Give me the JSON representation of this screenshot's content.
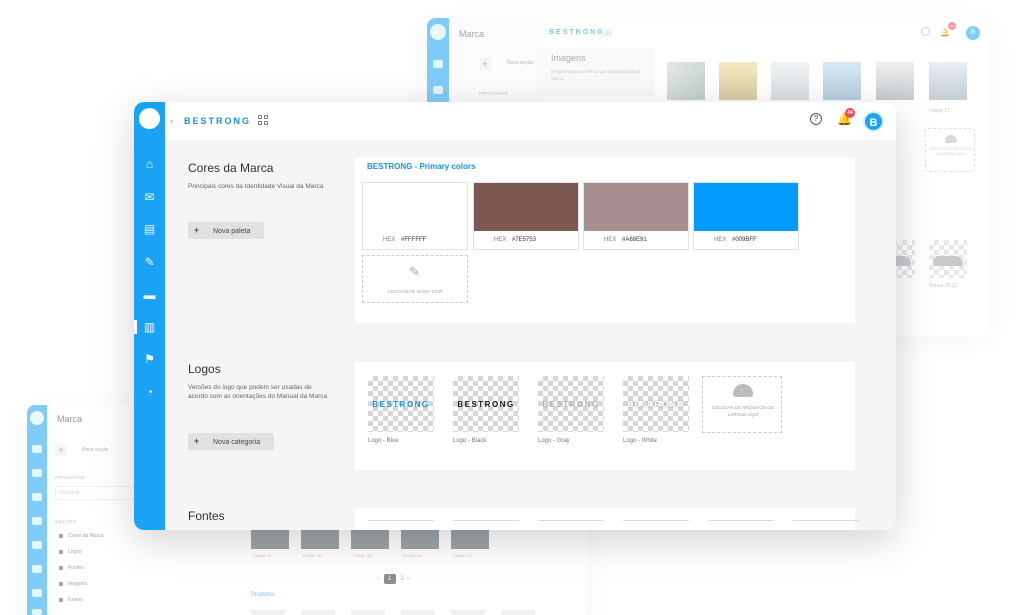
{
  "bg_top": {
    "title": "Marca",
    "new_section": "Nova seção",
    "search_label": "PROCURAR",
    "brand": "BESTRONG",
    "notif_count": "44",
    "avatar": "B",
    "images_title": "Imagens",
    "images_desc": "Imagem para uso em peças Institucionais da Marca",
    "caps": [
      "8",
      "Image 17"
    ],
    "upload_text": "ESCOLHA OS ARQUIVOS OU LARGUE AQUI",
    "shoe_caps": [
      "2",
      "Shoes 03 (2)"
    ]
  },
  "bg_bottom": {
    "title": "Marca",
    "new_section": "Nova seção",
    "search_label": "PROCURAR",
    "search_placeholder": "Procurar...",
    "sections_label": "SEÇÕES",
    "sections": [
      "Cores da Marca",
      "Logos",
      "Fontes",
      "Imagens",
      "Ícones"
    ],
    "gallery_caps": [
      "Image 11",
      "Image 10",
      "Image 15",
      "Image 14",
      "Image 12"
    ],
    "pages": [
      "1",
      "2"
    ],
    "products_label": "Produtos"
  },
  "main": {
    "brand": "BESTRONG",
    "notif_count": "44",
    "avatar": "B",
    "help": "?",
    "colors": {
      "title": "Cores da Marca",
      "desc": "Principais cores da Identidade Visual da Marca",
      "button": "Nova paleta",
      "panel_title": "BESTRONG - Primary colors",
      "hex_label": "HEX",
      "swatches": [
        {
          "hex": "#FFFFFF",
          "color": "#FFFFFF"
        },
        {
          "hex": "#7E5753",
          "color": "#7E5753"
        },
        {
          "hex": "#A68E91",
          "color": "#A68E91"
        },
        {
          "hex": "#009BFF",
          "color": "#009BFF"
        }
      ],
      "add_color": "ADICIONAR NOVA COR"
    },
    "logos": {
      "title": "Logos",
      "desc": "Versões do logo que podem ser usadas de acordo com as orientações do Manual da Marca",
      "button": "Nova categoria",
      "wordmark": "BESTRONG",
      "items": [
        {
          "label": "Logo - Blue",
          "color": "#1793e6"
        },
        {
          "label": "Logo - Black",
          "color": "#1a1a1a"
        },
        {
          "label": "Logo - Gray",
          "color": "#b3b3b3"
        },
        {
          "label": "Logo - White",
          "color": "#ffffff"
        }
      ],
      "upload_text": "ESCOLHA OS ARQUIVOS OU LARGUE AQUI"
    },
    "fonts": {
      "title": "Fontes"
    }
  }
}
